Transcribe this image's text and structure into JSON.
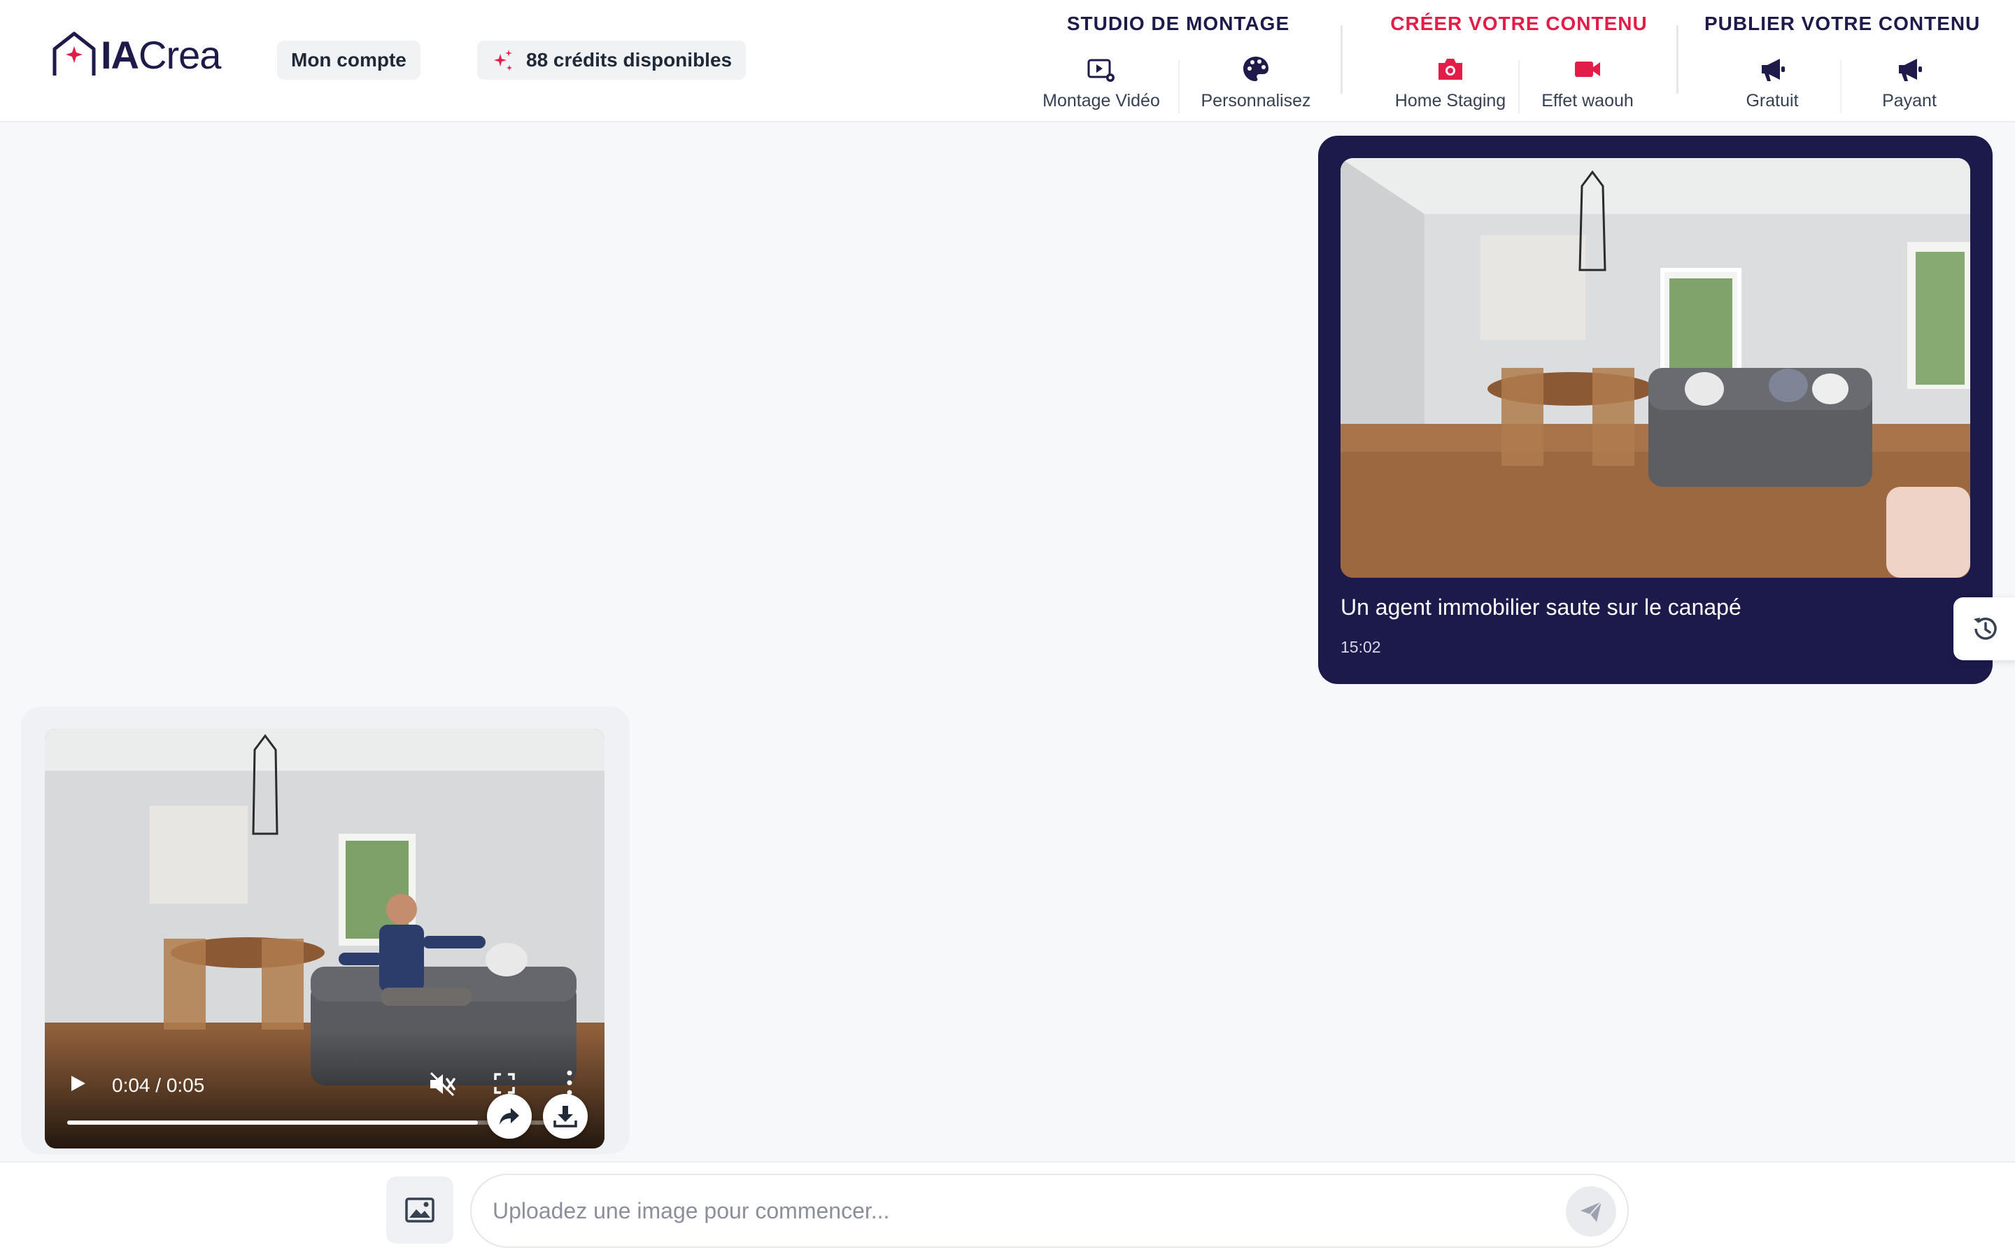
{
  "brand": {
    "name_bold": "IA",
    "name_light": "Crea"
  },
  "header": {
    "account_label": "Mon compte",
    "credits_label": "88 crédits disponibles"
  },
  "nav": {
    "studio": {
      "title": "STUDIO DE MONTAGE",
      "items": [
        {
          "label": "Montage Vidéo",
          "icon": "video-settings-icon"
        },
        {
          "label": "Personnalisez",
          "icon": "palette-icon"
        }
      ]
    },
    "create": {
      "title": "CRÉER VOTRE CONTENU",
      "items": [
        {
          "label": "Home Staging",
          "icon": "camera-icon"
        },
        {
          "label": "Effet waouh",
          "icon": "video-camera-icon"
        }
      ]
    },
    "publish": {
      "title": "PUBLIER VOTRE CONTENU",
      "items": [
        {
          "label": "Gratuit",
          "icon": "megaphone-icon"
        },
        {
          "label": "Payant",
          "icon": "megaphone-icon"
        }
      ]
    }
  },
  "prompt": {
    "text": "Un agent immobilier saute sur le canapé",
    "time": "15:02"
  },
  "video": {
    "time_display": "0:04 / 0:05",
    "progress": 0.8
  },
  "composer": {
    "placeholder": "Uploadez une image pour commencer..."
  },
  "colors": {
    "primary": "#1e1b4b",
    "card": "#1b1a4a",
    "accent": "#e11d48"
  }
}
